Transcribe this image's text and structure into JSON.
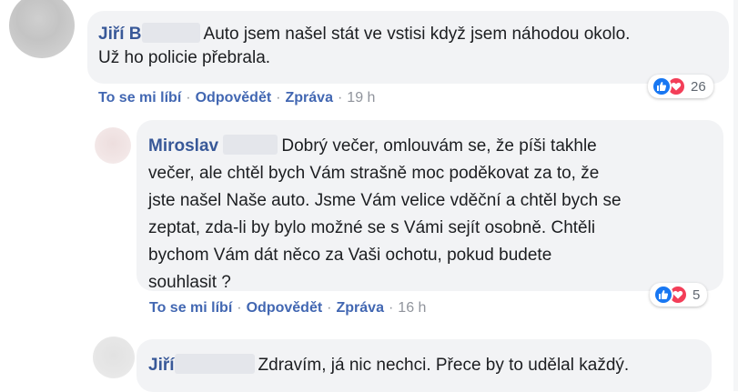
{
  "comments": [
    {
      "author": "Jiří B",
      "text_line1": "Auto jsem našel stát ve vstisi když jsem náhodou okolo.",
      "text_line2": "Už ho policie přebrala.",
      "actions": {
        "like": "To se mi líbí",
        "reply": "Odpovědět",
        "message": "Zpráva",
        "time": "19 h"
      },
      "reactions": {
        "count": "26",
        "icons": [
          "like-icon",
          "love-icon"
        ]
      }
    },
    {
      "author": "Miroslav",
      "lines": [
        "Dobrý večer, omlouvám se, že píši takhle",
        "večer, ale chtěl bych Vám strašně moc poděkovat za to, že",
        "jste našel Naše auto. Jsme Vám velice vděční a chtěl bych se",
        "zeptat, zda-li by bylo možné se s Vámi sejít osobně. Chtěli",
        "bychom Vám dát něco za Vaši ochotu, pokud budete",
        "souhlasit ?"
      ],
      "actions": {
        "like": "To se mi líbí",
        "reply": "Odpovědět",
        "message": "Zpráva",
        "time": "16 h"
      },
      "reactions": {
        "count": "5",
        "icons": [
          "like-icon",
          "love-icon"
        ]
      }
    },
    {
      "author": "Jiří",
      "text": "Zdravím, já nic nechci. Přece by to udělal každý."
    }
  ],
  "separator": "·",
  "colors": {
    "name": "#385898",
    "link": "#4267b2",
    "bubble": "#f2f3f5",
    "like": "#1877f2",
    "love": "#f33e58"
  }
}
